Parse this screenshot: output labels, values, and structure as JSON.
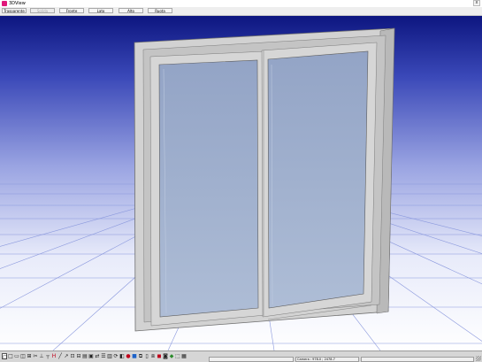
{
  "window": {
    "title": "3DView",
    "close_symbol": "x"
  },
  "toolbar": {
    "buttons": [
      {
        "label": "Trasparente",
        "enabled": true
      },
      {
        "label": "Solida",
        "enabled": false
      },
      {
        "label": "Fronte",
        "enabled": true
      },
      {
        "label": "Lato",
        "enabled": true
      },
      {
        "label": "Alto",
        "enabled": true
      },
      {
        "label": "Ruota",
        "enabled": true
      }
    ]
  },
  "scene": {
    "sky_colors": [
      "#0d1680",
      "#5560c4",
      "#ffffff"
    ],
    "floor_grid_color": "#8a98dd",
    "frame_color": "#d2d2d2",
    "glass_color": "#9fb1cc"
  },
  "bottom_toolbar": {
    "tools": [
      "select-icon",
      "copy-icon",
      "paste-icon",
      "cut-icon",
      "measure-icon",
      "scissors-icon",
      "align-icon",
      "handle-icon",
      "pen-icon",
      "line-icon",
      "ruler-icon",
      "grid-icon",
      "table-icon",
      "frame-icon",
      "rectangle-icon",
      "arrows-icon",
      "layers-icon",
      "panel-icon",
      "rotate-icon",
      "box-icon",
      "record-icon",
      "color-icon",
      "window-icon",
      "page-icon",
      "duplicate-icon",
      "save-icon",
      "lock-icon",
      "cube-icon",
      "export-icon",
      "print-icon"
    ],
    "status_left": "",
    "status_coords": "Camera : 978.0 ; 2478.7",
    "status_right": ""
  }
}
